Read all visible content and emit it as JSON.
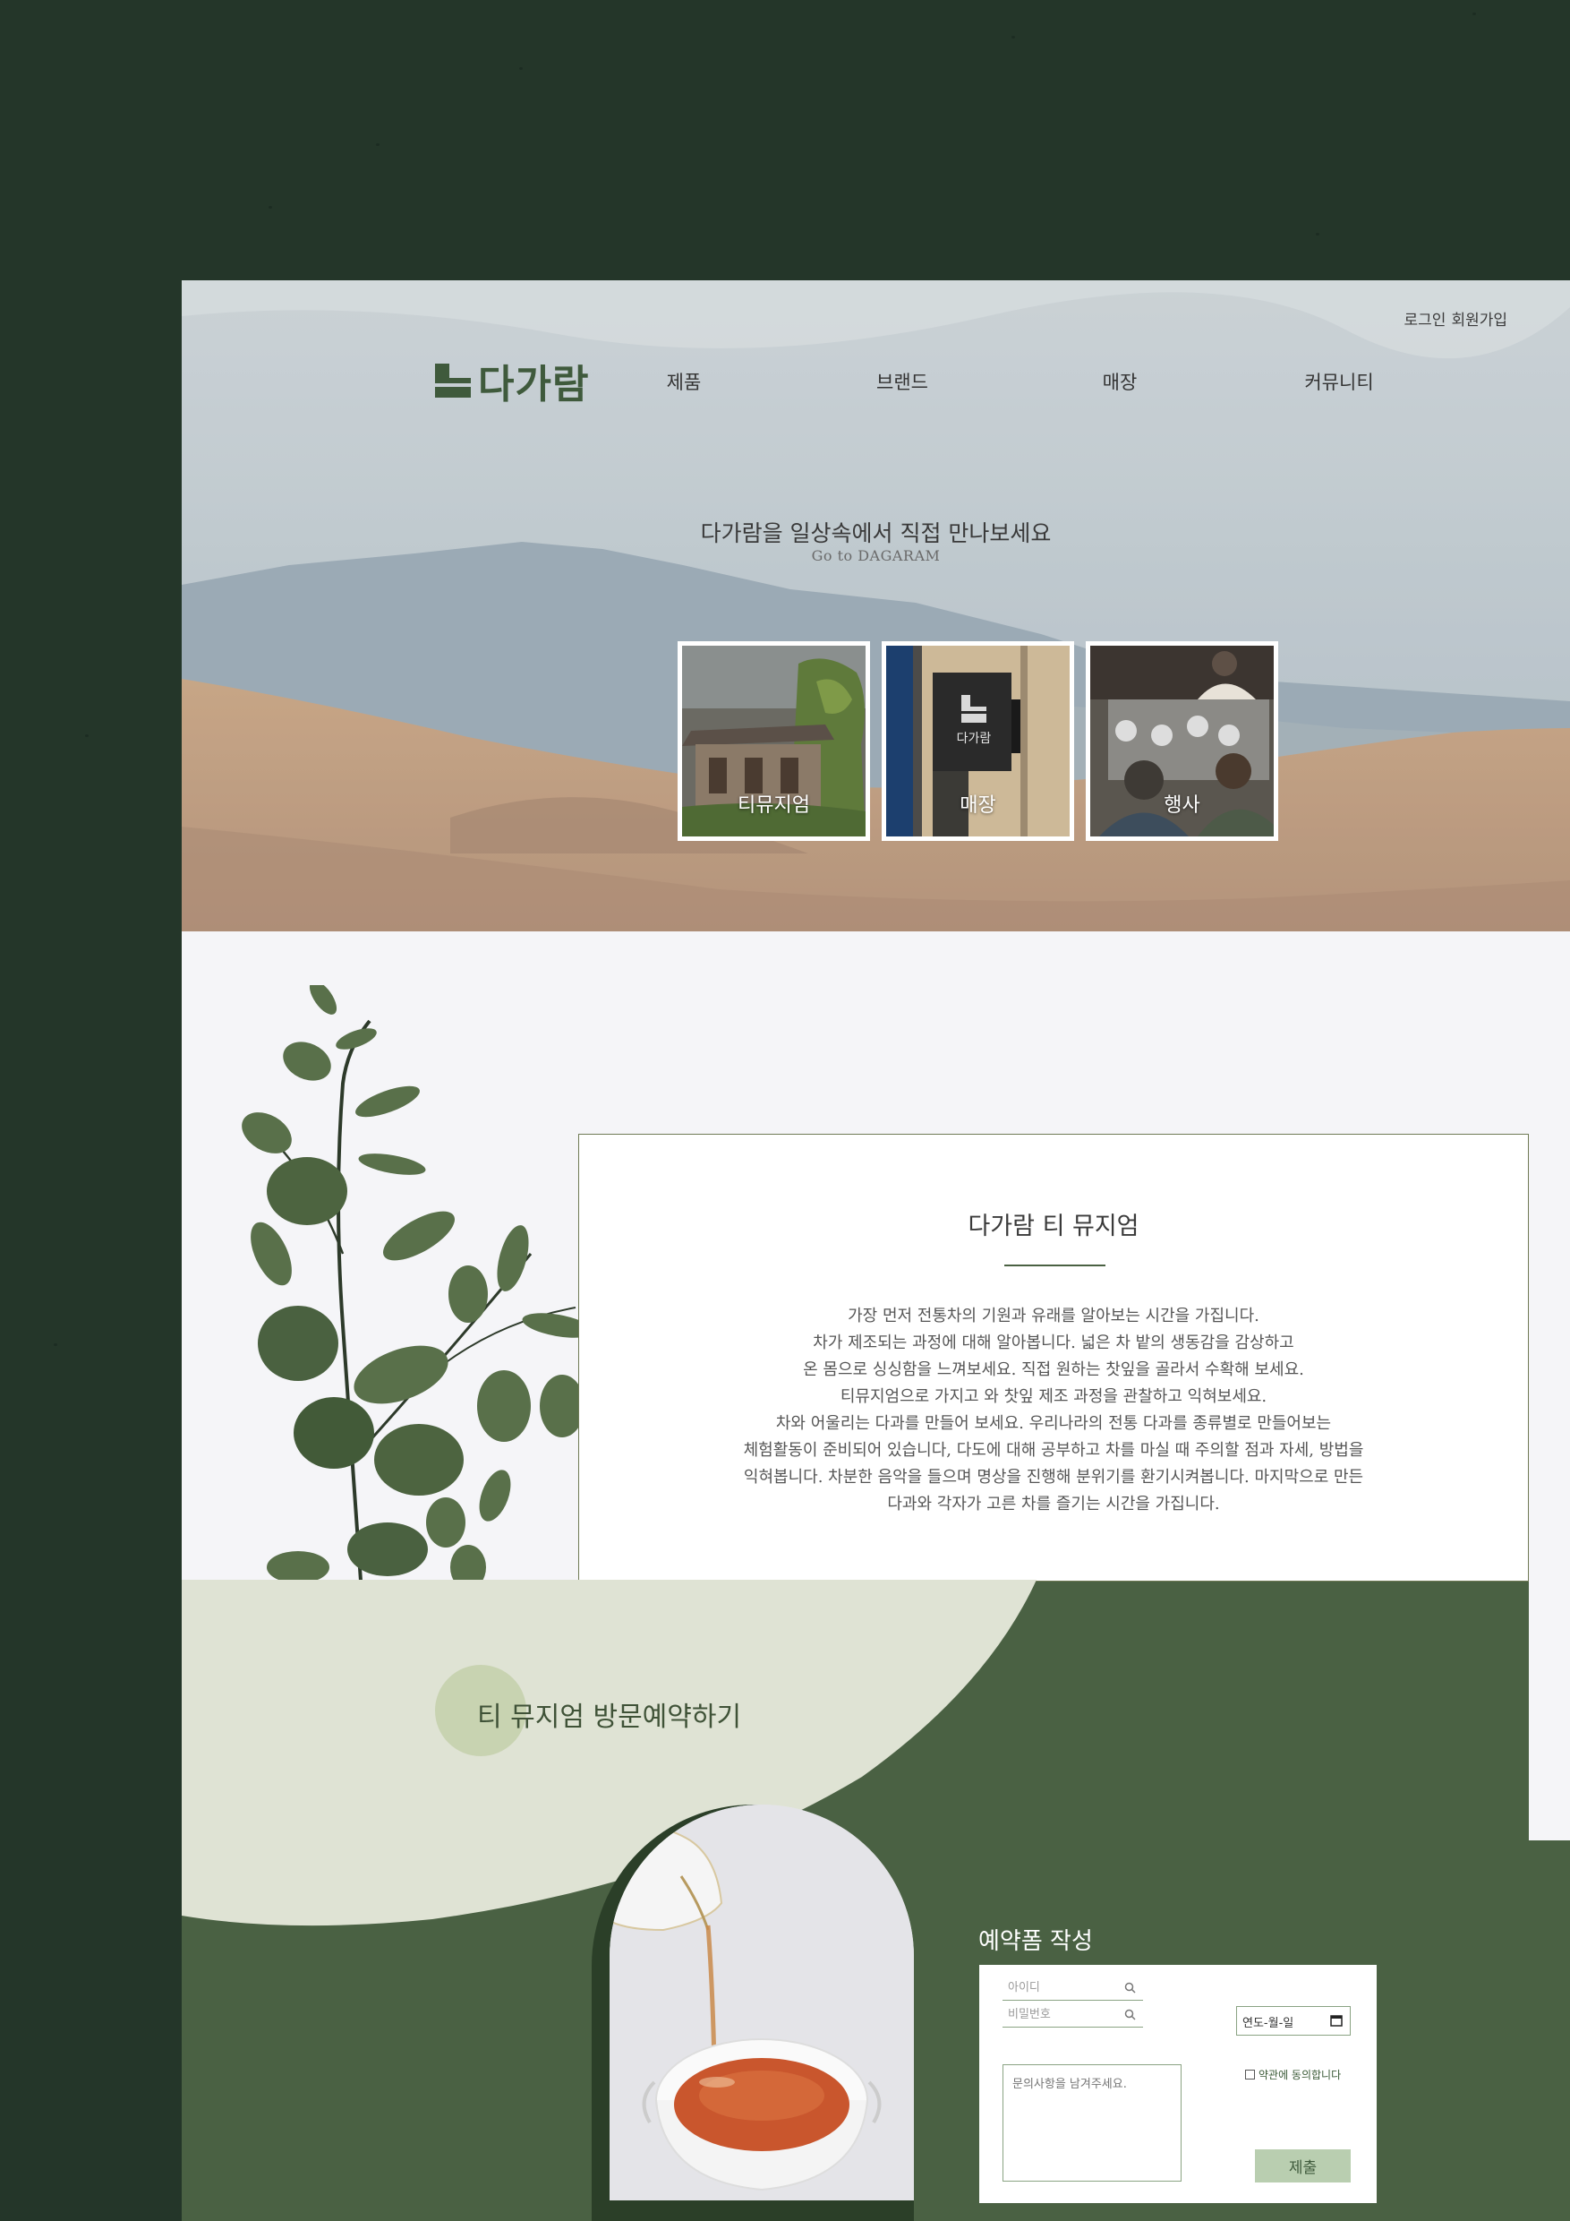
{
  "header": {
    "utility_links": [
      "로그인",
      "회원가입"
    ],
    "logo_text": "다가람",
    "nav": [
      "제품",
      "브랜드",
      "매장",
      "커뮤니티"
    ]
  },
  "hero": {
    "title": "다가람을 일상속에서 직접 만나보세요",
    "subtitle": "Go to DAGARAM",
    "cards": [
      {
        "label": "티뮤지엄"
      },
      {
        "label": "매장",
        "sign_text": "다가람"
      },
      {
        "label": "행사"
      }
    ]
  },
  "museum": {
    "title": "다가람 티 뮤지엄",
    "body": [
      "가장 먼저 전통차의 기원과 유래를 알아보는 시간을 가집니다.",
      "차가 제조되는 과정에 대해 알아봅니다. 넓은 차 밭의 생동감을 감상하고",
      "온 몸으로 싱싱함을 느껴보세요. 직접 원하는 찻잎을 골라서 수확해 보세요.",
      "티뮤지엄으로 가지고 와 찻잎 제조 과정을 관찰하고 익혀보세요.",
      "차와 어울리는 다과를 만들어 보세요. 우리나라의 전통 다과를 종류별로 만들어보는",
      "체험활동이 준비되어 있습니다, 다도에 대해 공부하고 차를 마실 때 주의할 점과 자세, 방법을",
      "익혀봅니다. 차분한 음악을 들으며 명상을 진행해 분위기를 환기시켜봅니다. 마지막으로 만든",
      "다과와 각자가 고른 차를 즐기는 시간을 가집니다."
    ]
  },
  "reservation": {
    "title": "티 뮤지엄 방문예약하기",
    "form_title": "예약폼 작성",
    "id_placeholder": "아이디",
    "password_placeholder": "비밀번호",
    "date_placeholder": "연도-월-일",
    "agree_label": "약관에 동의합니다",
    "memo_placeholder": "문의사항을 남겨주세요.",
    "submit_label": "제출"
  },
  "colors": {
    "backdrop": "#243629",
    "brand_green": "#4a6143",
    "light_sage": "#dfe3d4",
    "button_sage": "#b9ceb0"
  },
  "icons": [
    "logo-mark-icon",
    "search-icon",
    "calendar-icon",
    "checkbox-icon"
  ]
}
